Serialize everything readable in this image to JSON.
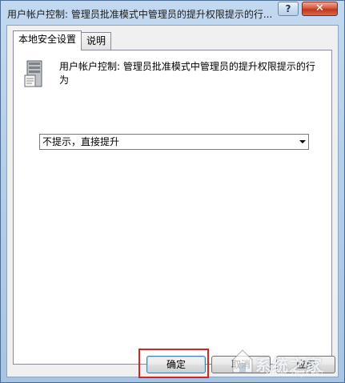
{
  "window": {
    "title": "用户帐户控制: 管理员批准模式中管理员的提升权限提示的行...",
    "help_label": "?",
    "close_label": "✕"
  },
  "tabs": [
    {
      "label": "本地安全设置",
      "active": true
    },
    {
      "label": "说明",
      "active": false
    }
  ],
  "policy": {
    "icon": "server-policy-icon",
    "text": "用户帐户控制: 管理员批准模式中管理员的提升权限提示的行为"
  },
  "behavior_select": {
    "value": "不提示，直接提升"
  },
  "buttons": {
    "ok": "确定",
    "cancel": "取消",
    "apply": "应用"
  },
  "watermark": {
    "text": "系统之家",
    "sub": "XITONGZHIJIA.NET"
  },
  "colors": {
    "highlight": "#e0201c",
    "close_button": "#c1351d"
  }
}
